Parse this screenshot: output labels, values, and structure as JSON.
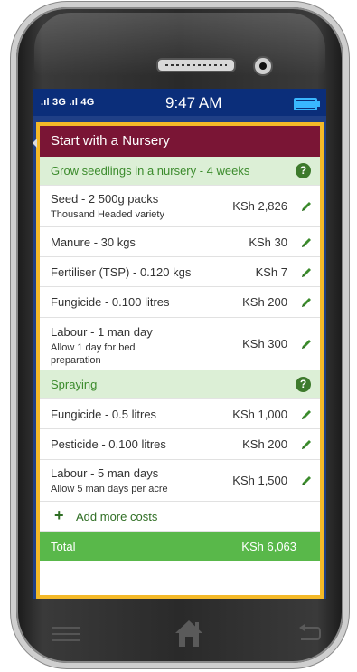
{
  "status_bar": {
    "signal": ".ıl 3G .ıl 4G",
    "time": "9:47 AM"
  },
  "page": {
    "title": "Start with a Nursery"
  },
  "sections": [
    {
      "header": "Grow seedlings in a nursery - 4 weeks",
      "items": [
        {
          "label": "Seed - 2 500g packs",
          "note": "Thousand Headed variety",
          "amount": "KSh 2,826"
        },
        {
          "label": "Manure - 30 kgs",
          "note": "",
          "amount": "KSh 30"
        },
        {
          "label": "Fertiliser (TSP) - 0.120 kgs",
          "note": "",
          "amount": "KSh 7"
        },
        {
          "label": "Fungicide - 0.100 litres",
          "note": "",
          "amount": "KSh 200"
        },
        {
          "label": "Labour - 1 man day",
          "note": "Allow 1 day for bed preparation",
          "amount": "KSh 300"
        }
      ]
    },
    {
      "header": "Spraying",
      "items": [
        {
          "label": "Fungicide - 0.5 litres",
          "note": "",
          "amount": "KSh 1,000"
        },
        {
          "label": "Pesticide - 0.100 litres",
          "note": "",
          "amount": "KSh 200"
        },
        {
          "label": "Labour - 5 man days",
          "note": "Allow 5 man days per acre",
          "amount": "KSh 1,500"
        }
      ]
    }
  ],
  "add_more": {
    "icon": "plus-icon",
    "label": "Add more costs"
  },
  "total": {
    "label": "Total",
    "amount": "KSh 6,063"
  },
  "help_icon": "?",
  "colors": {
    "title_bar": "#7a1535",
    "section_header_bg": "#dcefd6",
    "accent_green": "#3b8b2c",
    "total_bar": "#59b84a",
    "frame": "#f4b928",
    "status_bar": "#0b2e7a"
  }
}
